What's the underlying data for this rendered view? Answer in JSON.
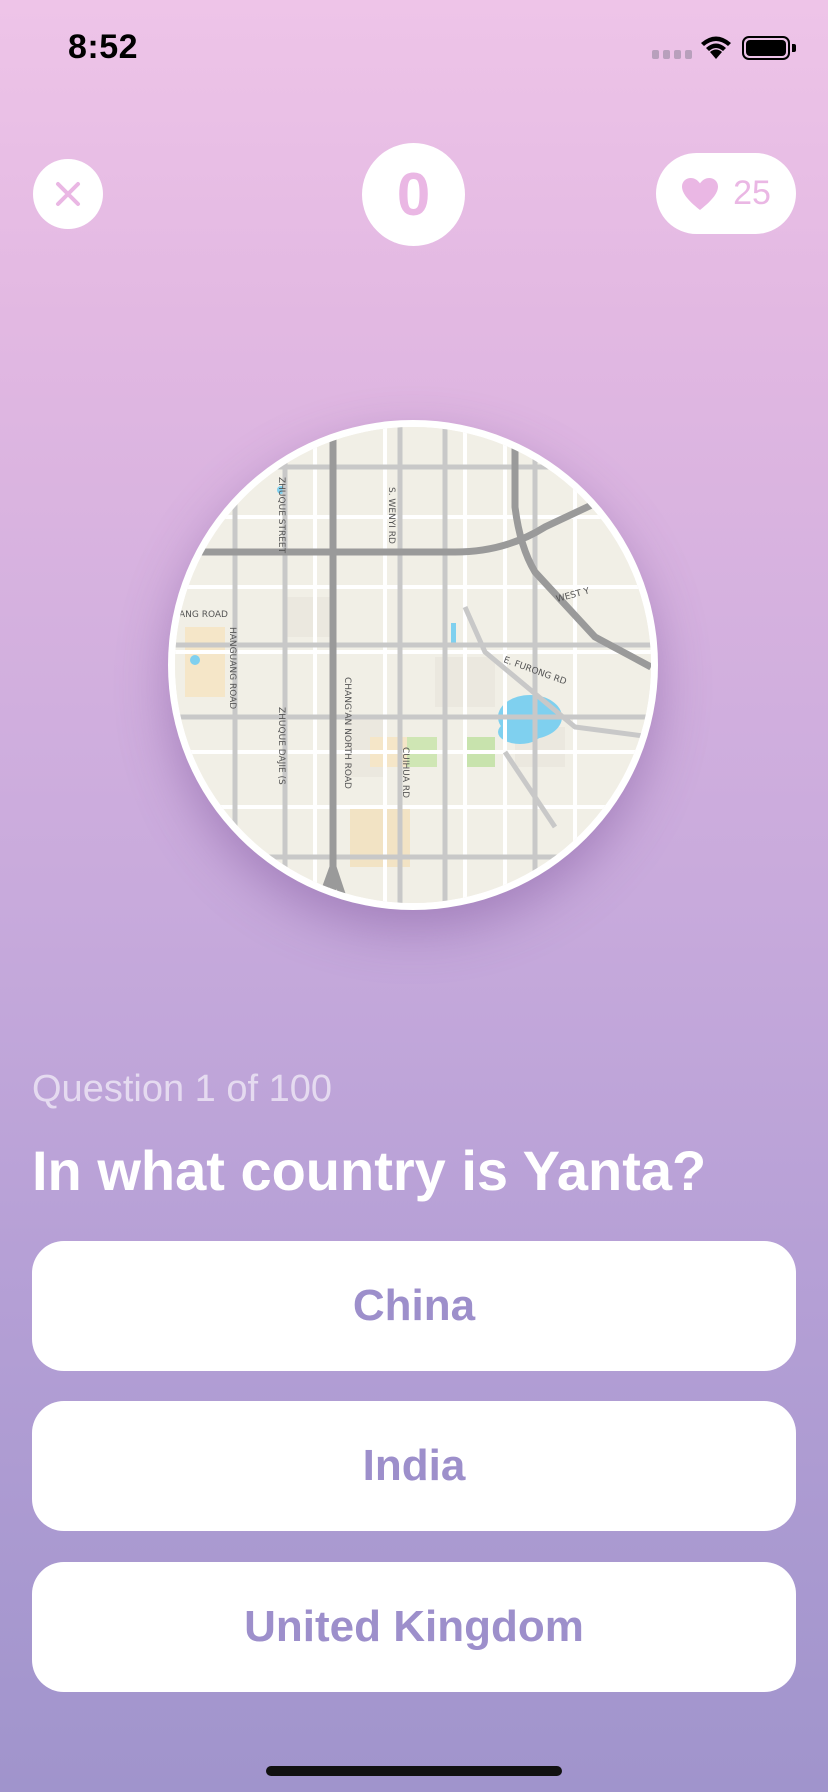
{
  "status_bar": {
    "time": "8:52"
  },
  "header": {
    "score": "0",
    "lives": "25"
  },
  "map": {
    "labels": [
      "CHANG'AN NORTH ROAD",
      "ZHUQUE STREET",
      "S. WENYI RD",
      "ANG ROAD",
      "HANGUANG ROAD",
      "ZHUQUE DAJIE (S",
      "CUIHUA RD",
      "E. FURONG RD",
      "WEST Y"
    ]
  },
  "quiz": {
    "progress": "Question 1 of 100",
    "question": "In what country is Yanta?",
    "answers": [
      "China",
      "India",
      "United Kingdom"
    ]
  },
  "colors": {
    "accent_pink": "#eab7e4",
    "answer_text": "#9d8fcb"
  }
}
